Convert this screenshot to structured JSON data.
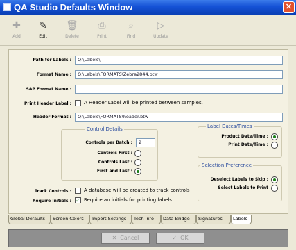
{
  "window": {
    "title": "QA Studio Defaults Window",
    "close_glyph": "✕"
  },
  "toolbar": {
    "add": {
      "label": "Add",
      "icon": "add-icon",
      "glyph": "✚"
    },
    "edit": {
      "label": "Edit",
      "icon": "edit-icon",
      "glyph": "✎"
    },
    "delete": {
      "label": "Delete",
      "icon": "trash-icon",
      "glyph": "🗑"
    },
    "print": {
      "label": "Print",
      "icon": "printer-icon",
      "glyph": "⎙"
    },
    "find": {
      "label": "Find",
      "icon": "find-icon",
      "glyph": "⌕"
    },
    "update": {
      "label": "Update",
      "icon": "update-icon",
      "glyph": "▷"
    }
  },
  "form": {
    "path_for_labels": {
      "label": "Path for Labels :",
      "value": "Q:\\Labels\\"
    },
    "format_name": {
      "label": "Format Name :",
      "value": "Q:\\Labels\\FORMATS\\Zebra2844.btw"
    },
    "sap_format_name": {
      "label": "SAP Format Name :",
      "value": ""
    },
    "print_header_label": {
      "label": "Print Header Label :",
      "text": "A Header Label will be printed between samples.",
      "checked": false
    },
    "header_format": {
      "label": "Header Format :",
      "value": "Q:\\Labels\\FORMATS\\header.btw"
    },
    "track_controls": {
      "label": "Track Controls :",
      "text": "A database will be created to track controls",
      "checked": false
    },
    "require_initials": {
      "label": "Require Initials :",
      "text": "Require an initials for printing labels.",
      "checked": true,
      "check_glyph": "✓"
    }
  },
  "control_details": {
    "title": "Control Details",
    "controls_per_batch": {
      "label": "Controls per Batch :",
      "value": "2"
    },
    "options": [
      {
        "label": "Controls First :",
        "selected": false
      },
      {
        "label": "Controls Last :",
        "selected": false
      },
      {
        "label": "First and Last :",
        "selected": true
      }
    ]
  },
  "label_dates": {
    "title": "Label Dates/Times",
    "options": [
      {
        "label": "Product Date/Time :",
        "selected": true
      },
      {
        "label": "Print Date/Time :",
        "selected": false
      }
    ]
  },
  "selection_preference": {
    "title": "Selection Preference",
    "options": [
      {
        "label": "Deselect Labels to Skip :",
        "selected": true
      },
      {
        "label": "Select Labels to Print",
        "selected": false
      }
    ]
  },
  "tabs": [
    {
      "label": "Global Defaults",
      "active": false
    },
    {
      "label": "Screen Colors",
      "active": false
    },
    {
      "label": "Import Settings",
      "active": false
    },
    {
      "label": "Tech Info",
      "active": false
    },
    {
      "label": "Data Bridge",
      "active": false
    },
    {
      "label": "Signatures",
      "active": false
    },
    {
      "label": "Labels",
      "active": true
    }
  ],
  "buttons": {
    "cancel": {
      "label": "Cancel",
      "glyph": "✕"
    },
    "ok": {
      "label": "OK",
      "glyph": "✓"
    }
  },
  "colors": {
    "titlebar": "#1552d6",
    "accent_text": "#2a4c9e",
    "check": "#1c7e18"
  }
}
